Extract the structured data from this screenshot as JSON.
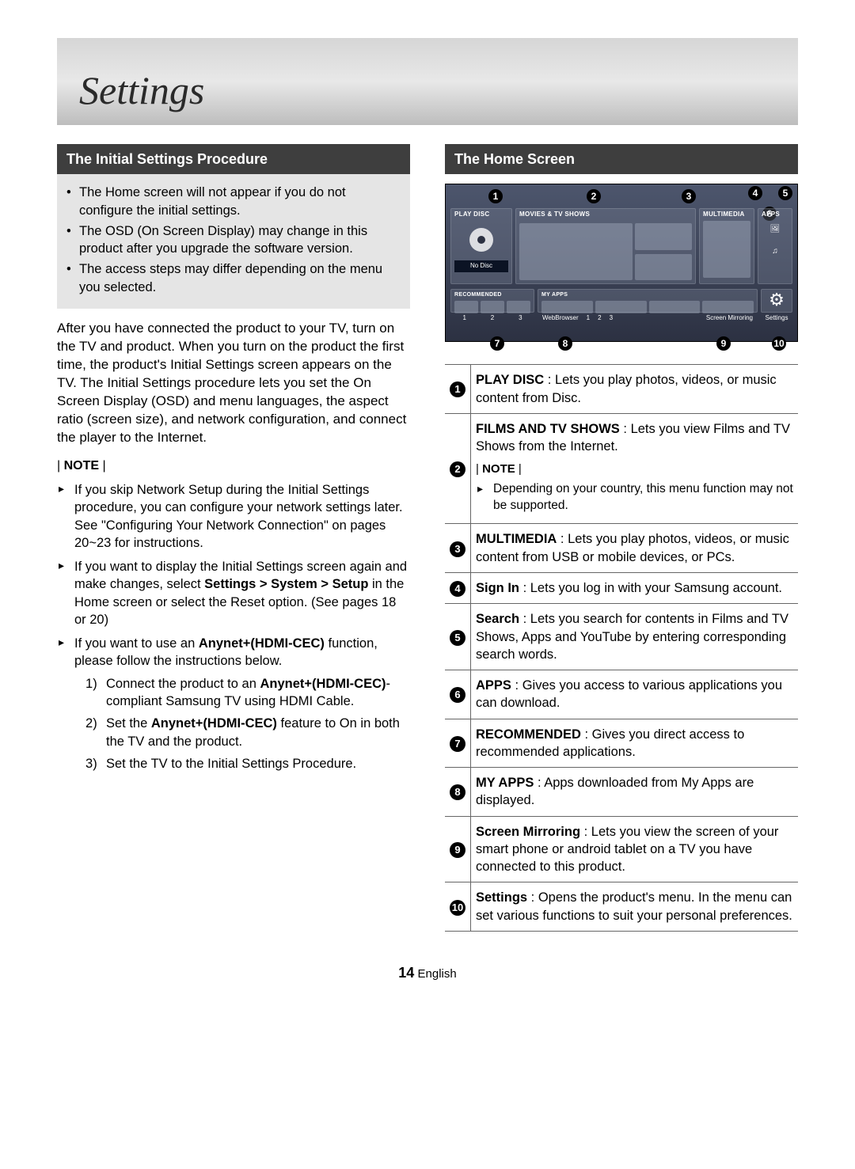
{
  "header": {
    "title": "Settings"
  },
  "left": {
    "section_header": "The Initial Settings Procedure",
    "grey_bullets": [
      "The Home screen will not appear if you do not configure the initial settings.",
      "The OSD (On Screen Display) may change in this product after you upgrade the software version.",
      "The access steps may differ depending on the menu you selected."
    ],
    "intro_para": "After you have connected the product to your TV, turn on the TV and product. When you turn on the product the first time, the product's Initial Settings screen appears on the TV. The Initial Settings procedure lets you set the On Screen Display (OSD) and menu languages, the aspect ratio (screen size), and network configuration, and connect the player to the Internet.",
    "note_label": "NOTE",
    "notes": {
      "n1": "If you skip Network Setup during the Initial Settings procedure, you can configure your network settings later. See \"Configuring Your Network Connection\" on pages 20~23 for instructions.",
      "n2_prefix": "If you want to display the Initial Settings screen again and make changes, select ",
      "n2_path": "Settings > System > Setup",
      "n2_suffix": " in the Home screen or select the Reset option. (See pages 18 or 20)",
      "n3_prefix": "If you want to use an ",
      "n3_bold": "Anynet+(HDMI-CEC)",
      "n3_suffix": " function, please follow the instructions below.",
      "s1_prefix": "Connect the product to an ",
      "s1_bold": "Anynet+(HDMI-CEC)",
      "s1_suffix": "-compliant Samsung TV using HDMI Cable.",
      "s2_prefix": "Set the ",
      "s2_bold": "Anynet+(HDMI-CEC)",
      "s2_suffix": " feature to On in both the TV and the product.",
      "s3": "Set the TV to the Initial Settings Procedure."
    }
  },
  "right": {
    "section_header": "The Home Screen",
    "diagram": {
      "play_disc_label": "PLAY DISC",
      "play_disc_status": "No Disc",
      "movies_label": "MOVIES & TV SHOWS",
      "multimedia_label": "MULTIMEDIA",
      "apps_label": "APPS",
      "recommended_label": "RECOMMENDED",
      "myapps_label": "MY APPS",
      "web_browser": "WebBrowser",
      "screen_mirroring": "Screen Mirroring",
      "settings": "Settings",
      "seq_123_a": "1",
      "seq_123_b": "2",
      "seq_123_c": "3",
      "seq2_a": "1",
      "seq2_b": "2",
      "seq2_c": "3"
    },
    "legend": {
      "n1": "1",
      "n2": "2",
      "n3": "3",
      "n4": "4",
      "n5": "5",
      "n6": "6",
      "n7": "7",
      "n8": "8",
      "n9": "9",
      "n10": "10",
      "items": {
        "i1_bold": "PLAY DISC",
        "i1_rest": " : Lets you play photos, videos, or music content from Disc.",
        "i2_bold": "FILMS AND TV SHOWS",
        "i2_rest": " : Lets you view Films and TV Shows from the Internet.",
        "i2_note_label": "NOTE",
        "i2_note_item": "Depending on your country, this menu function may not be supported.",
        "i3_bold": "MULTIMEDIA",
        "i3_rest": " : Lets you play photos, videos, or music content from USB or mobile devices, or PCs.",
        "i4_bold": "Sign In",
        "i4_rest": " : Lets you log in with your Samsung account.",
        "i5_bold": "Search",
        "i5_rest": " : Lets you search for contents in Films and TV Shows, Apps and YouTube by entering corresponding search words.",
        "i6_bold": "APPS",
        "i6_rest": " : Gives you access to various applications you can download.",
        "i7_bold": "RECOMMENDED",
        "i7_rest": " : Gives you direct access to recommended applications.",
        "i8_bold": "MY APPS",
        "i8_rest": " : Apps downloaded from My Apps are displayed.",
        "i9_bold": "Screen Mirroring",
        "i9_rest": " : Lets you view the screen of your smart phone or android tablet on a TV you have connected to this product.",
        "i10_bold": "Settings",
        "i10_rest": " : Opens the product's menu. In the menu can set various functions to suit your personal preferences."
      }
    }
  },
  "footer": {
    "num": "14",
    "lang": "English"
  }
}
